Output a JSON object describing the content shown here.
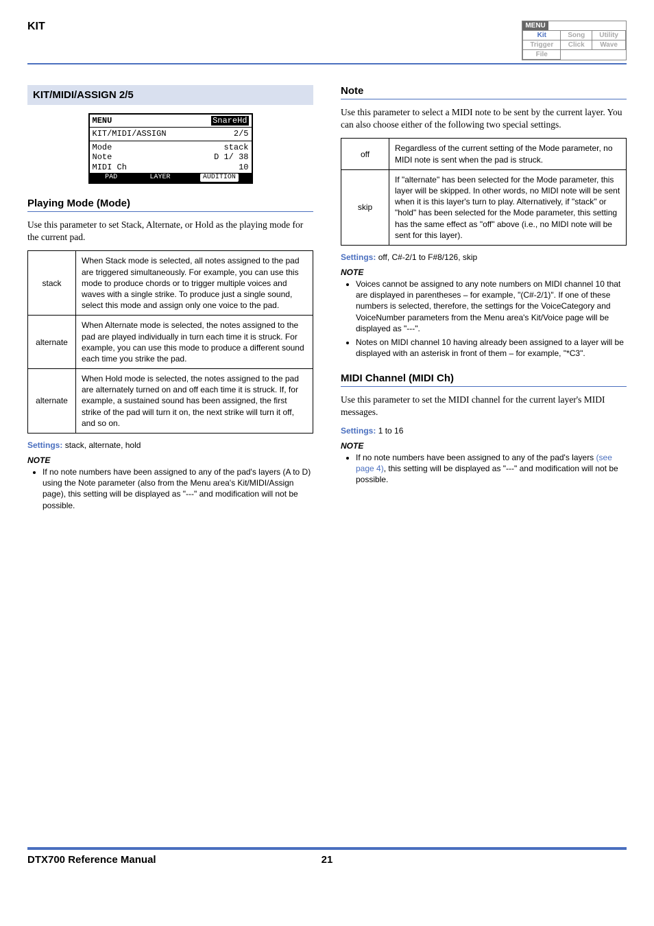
{
  "header": {
    "kit_label": "KIT",
    "menu_title": "MENU",
    "tabs": {
      "r1": [
        "Kit",
        "Song",
        "Utility"
      ],
      "r2": [
        "Trigger",
        "Click",
        "Wave"
      ],
      "r3": [
        "File"
      ]
    }
  },
  "left": {
    "bar_title": "KIT/MIDI/ASSIGN  2/5",
    "lcd": {
      "menu": "MENU",
      "kit_name": "SnareHd",
      "path": "KIT/MIDI/ASSIGN",
      "page": "2/5",
      "rows": [
        {
          "label": "Mode",
          "value": "stack"
        },
        {
          "label": "Note",
          "value": "D 1/ 38"
        },
        {
          "label": "MIDI Ch",
          "value": "10"
        }
      ],
      "tabs": [
        "PAD",
        "LAYER",
        "AUDITION"
      ]
    },
    "section1_title": "Playing Mode (Mode)",
    "section1_text": "Use this parameter to set Stack, Alternate, or Hold as the playing mode for the current pad.",
    "mode_table": [
      {
        "key": "stack",
        "desc": "When Stack mode is selected, all notes assigned to the pad are triggered simultaneously. For example, you can use this mode to produce chords or to trigger multiple voices and waves with a single strike. To produce just a single sound, select this mode and assign only one voice to the pad."
      },
      {
        "key": "alternate",
        "desc": "When Alternate mode is selected, the notes assigned to the pad are played individually in turn each time it is struck. For example, you can use this mode to produce a different sound each time you strike the pad."
      },
      {
        "key": "alternate",
        "desc": "When Hold mode is selected, the notes assigned to the pad are alternately turned on and off each time it is struck. If, for example, a sustained sound has been assigned, the first strike of the pad will turn it on, the next strike will turn it off, and so on."
      }
    ],
    "settings_label": "Settings:",
    "settings_value": "stack, alternate, hold",
    "note_head": "NOTE",
    "note_items": [
      "If no note numbers have been assigned to any of the pad's layers (A to D) using the Note parameter (also from the Menu area's Kit/MIDI/Assign page), this setting will be displayed as \"---\" and modification will not be possible."
    ]
  },
  "right": {
    "section1_title": "Note",
    "section1_text": "Use this parameter to select a MIDI note to be sent by the current layer. You can also choose either of the following two special settings.",
    "note_table": [
      {
        "key": "off",
        "desc": "Regardless of the current setting of the Mode parameter, no MIDI note is sent when the pad is struck."
      },
      {
        "key": "skip",
        "desc": "If \"alternate\" has been selected for the Mode parameter, this layer will be skipped. In other words, no MIDI note will be sent when it is this layer's turn to play. Alternatively, if \"stack\" or \"hold\" has been selected for the Mode parameter, this setting has the same effect as \"off\" above (i.e., no MIDI note will be sent for this layer)."
      }
    ],
    "settings1_label": "Settings:",
    "settings1_value": "off, C#-2/1 to F#8/126, skip",
    "note1_head": "NOTE",
    "note1_items": [
      "Voices cannot be assigned to any note numbers on MIDI channel 10 that are displayed in parentheses – for example, \"(C#-2/1)\". If one of these numbers is selected, therefore, the settings for the VoiceCategory and VoiceNumber parameters from the Menu area's Kit/Voice page will be displayed as \"---\".",
      "Notes on MIDI channel 10 having already been assigned to a layer will be displayed with an asterisk in front of them – for example, \"*C3\"."
    ],
    "section2_title": "MIDI Channel (MIDI Ch)",
    "section2_text": "Use this parameter to set the MIDI channel for the current layer's MIDI messages.",
    "settings2_label": "Settings:",
    "settings2_value": "1 to 16",
    "note2_head": "NOTE",
    "note2_items_pre": "If no note numbers have been assigned to any of the pad's layers ",
    "note2_link": "(see page 4)",
    "note2_items_post": ", this setting will be displayed as \"---\" and modification will not be possible."
  },
  "footer": {
    "left": "DTX700  Reference Manual",
    "page": "21"
  }
}
